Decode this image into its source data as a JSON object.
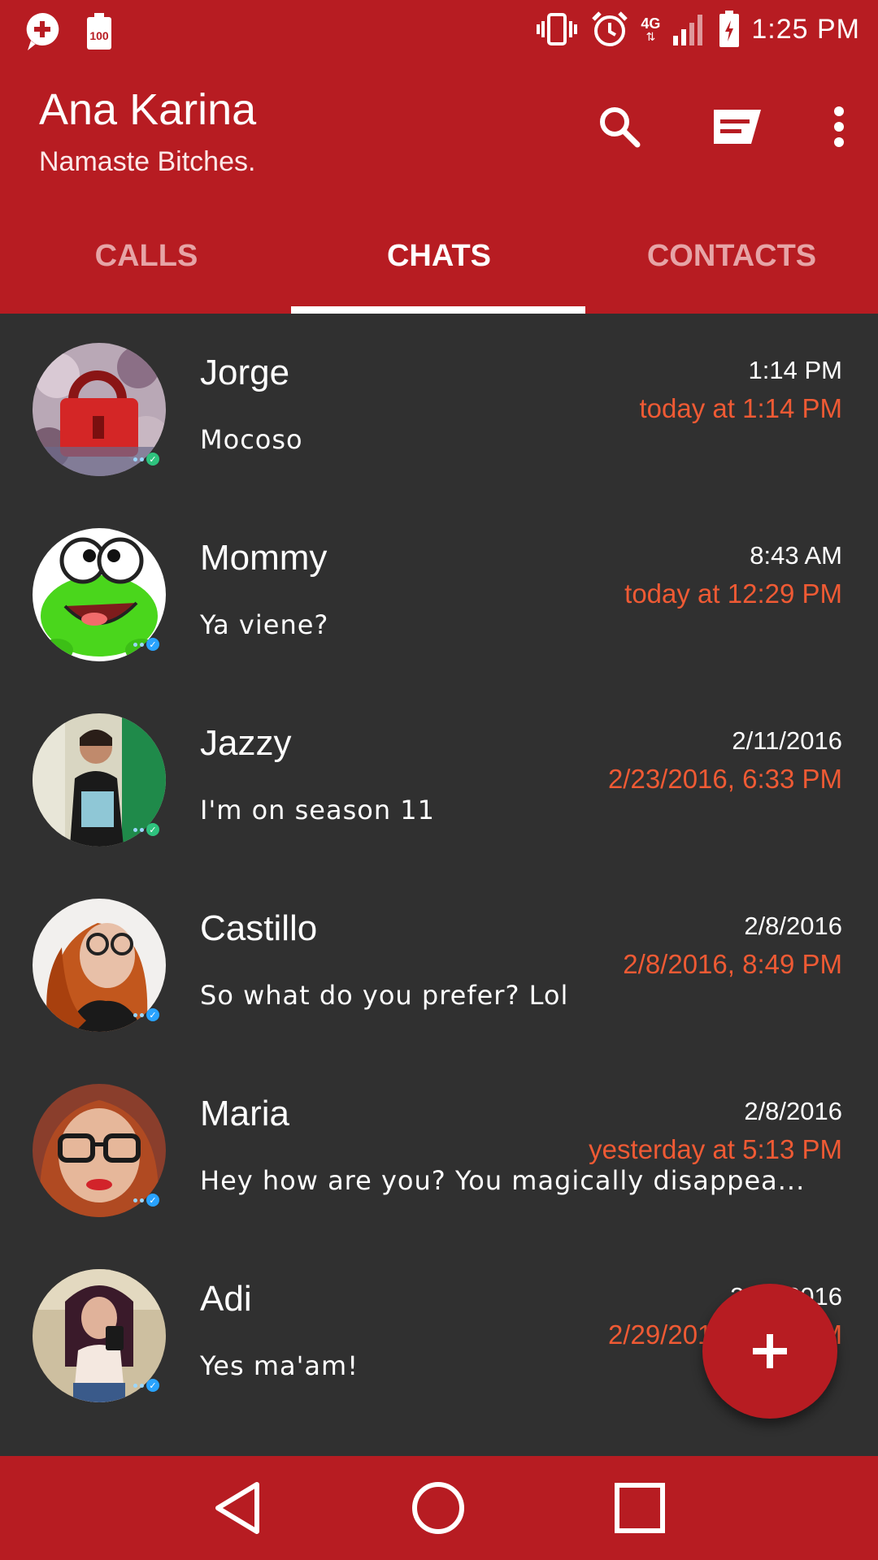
{
  "status_bar": {
    "time": "1:25 PM",
    "network": "4G",
    "left_icons": [
      "messenger-icon",
      "battery-saver-icon"
    ],
    "right_icons": [
      "vibrate-icon",
      "alarm-icon",
      "signal-icon",
      "battery-icon"
    ]
  },
  "app_bar": {
    "title": "Ana Karina",
    "subtitle": "Namaste Bitches.",
    "actions": [
      "search-icon",
      "new-message-icon",
      "more-options-icon"
    ]
  },
  "tabs": [
    {
      "label": "CALLS",
      "active": false
    },
    {
      "label": "CHATS",
      "active": true
    },
    {
      "label": "CONTACTS",
      "active": false
    }
  ],
  "chats": [
    {
      "name": "Jorge",
      "time": "1:14 PM",
      "last_seen": "today at 1:14 PM",
      "message": "Mocoso",
      "avatar": "lock-photo",
      "status_color": "#2ec27e"
    },
    {
      "name": "Mommy",
      "time": "8:43 AM",
      "last_seen": "today at 12:29 PM",
      "message": "Ya viene?",
      "avatar": "frog-cartoon",
      "status_color": "#29a3ff"
    },
    {
      "name": "Jazzy",
      "time": "2/11/2016",
      "last_seen": "2/23/2016, 6:33 PM",
      "message": "I'm on season 11",
      "avatar": "mirror-selfie",
      "status_color": "#2ec27e"
    },
    {
      "name": "Castillo",
      "time": "2/8/2016",
      "last_seen": "2/8/2016, 8:49 PM",
      "message": "So what do you prefer? Lol",
      "avatar": "portrait-glasses-red-hair",
      "status_color": "#29a3ff"
    },
    {
      "name": "Maria",
      "time": "2/8/2016",
      "last_seen": "yesterday at 5:13 PM",
      "message": "Hey how are you? You magically disappea...",
      "avatar": "portrait-glasses",
      "status_color": "#29a3ff"
    },
    {
      "name": "Adi",
      "time": "2/29/2016",
      "last_seen": "2/29/2016, 6:33 PM",
      "message": "Yes ma'am!",
      "avatar": "mirror-selfie-2",
      "status_color": "#29a3ff"
    }
  ],
  "fab": {
    "icon": "plus-icon"
  },
  "nav_bar": {
    "buttons": [
      "back-icon",
      "home-icon",
      "recents-icon"
    ]
  },
  "colors": {
    "primary": "#b71c22",
    "background": "#303030",
    "accent_text": "#ef5a34"
  }
}
